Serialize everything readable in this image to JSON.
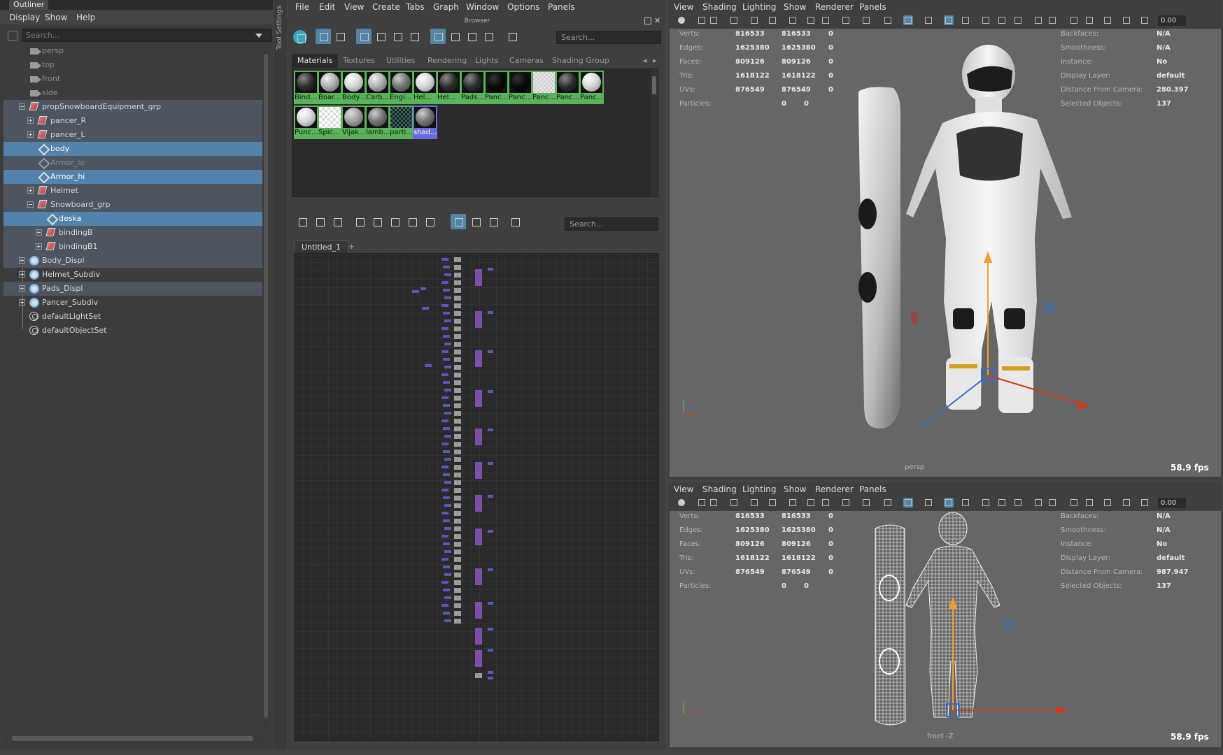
{
  "outliner": {
    "title": "Outliner",
    "menu": [
      "Display",
      "Show",
      "Help"
    ],
    "search_placeholder": "Search...",
    "items": [
      {
        "label": "persp",
        "icon": "camera-icon",
        "state": "dim"
      },
      {
        "label": "top",
        "icon": "camera-icon",
        "state": "dim"
      },
      {
        "label": "front",
        "icon": "camera-icon",
        "state": "dim"
      },
      {
        "label": "side",
        "icon": "camera-icon",
        "state": "dim"
      },
      {
        "label": "propSnowboardEquipment_grp",
        "icon": "transform-icon",
        "state": "grp"
      },
      {
        "label": "pancer_R",
        "icon": "transform-icon",
        "state": "grp"
      },
      {
        "label": "pancer_L",
        "icon": "transform-icon",
        "state": "grp"
      },
      {
        "label": "body",
        "icon": "mesh-icon",
        "state": "sel"
      },
      {
        "label": "Armor_lo",
        "icon": "mesh-icon",
        "state": "grpdim"
      },
      {
        "label": "Armor_hi",
        "icon": "mesh-icon",
        "state": "sel"
      },
      {
        "label": "Helmet",
        "icon": "transform-icon",
        "state": "grp"
      },
      {
        "label": "Snowboard_grp",
        "icon": "transform-icon",
        "state": "grp"
      },
      {
        "label": "deska",
        "icon": "mesh-icon",
        "state": "sel"
      },
      {
        "label": "bindingB",
        "icon": "transform-icon",
        "state": "grp"
      },
      {
        "label": "bindingB1",
        "icon": "transform-icon",
        "state": "grp"
      },
      {
        "label": "Body_Displ",
        "icon": "subdiv-icon",
        "state": "grp"
      },
      {
        "label": "Helmet_Subdiv",
        "icon": "subdiv-icon",
        "state": "normal"
      },
      {
        "label": "Pads_Displ",
        "icon": "subdiv-icon",
        "state": "grp"
      },
      {
        "label": "Pancer_Subdiv",
        "icon": "subdiv-icon",
        "state": "normal"
      },
      {
        "label": "defaultLightSet",
        "icon": "set-icon",
        "state": "normal"
      },
      {
        "label": "defaultObjectSet",
        "icon": "set-icon",
        "state": "normal"
      }
    ]
  },
  "tool_settings_label": "Tool Settings",
  "hypershade": {
    "menu": [
      "File",
      "Edit",
      "View",
      "Create",
      "Tabs",
      "Graph",
      "Window",
      "Options",
      "Panels"
    ],
    "browser_title": "Browser",
    "browser_search_placeholder": "Search...",
    "browser_tabs": [
      "Materials",
      "Textures",
      "Utilities",
      "Rendering",
      "Lights",
      "Cameras",
      "Shading Group"
    ],
    "active_browser_tab": "Materials",
    "swatches": [
      {
        "name": "Bind...",
        "look": "dark-noise"
      },
      {
        "name": "Boar...",
        "look": "grey"
      },
      {
        "name": "Body...",
        "look": "white"
      },
      {
        "name": "Carb...",
        "look": "grey"
      },
      {
        "name": "Engi...",
        "look": "grey-dark"
      },
      {
        "name": "Hel...",
        "look": "white"
      },
      {
        "name": "Hel...",
        "look": "dark-noise"
      },
      {
        "name": "Pads...",
        "look": "dark-noise"
      },
      {
        "name": "Panc...",
        "look": "black"
      },
      {
        "name": "Panc...",
        "look": "black"
      },
      {
        "name": "Panc...",
        "look": "checker-light"
      },
      {
        "name": "Panc...",
        "look": "dark-noise"
      },
      {
        "name": "Panc...",
        "look": "white"
      },
      {
        "name": "Punc...",
        "look": "white"
      },
      {
        "name": "Spic...",
        "look": "checker"
      },
      {
        "name": "Vijak...",
        "look": "grey-noise"
      },
      {
        "name": "lamb...",
        "look": "grey-dark"
      },
      {
        "name": "parti...",
        "look": "checker-dark"
      },
      {
        "name": "shad...",
        "look": "grey-dark",
        "selected": true
      }
    ],
    "graph_search_placeholder": "Search...",
    "graph_tab": "Untitled_1",
    "add_tab": "+"
  },
  "viewport_menu": [
    "View",
    "Shading",
    "Lighting",
    "Show",
    "Renderer",
    "Panels"
  ],
  "viewports": [
    {
      "camera": "persp",
      "fps": "58.9 fps",
      "field_value": "0.00",
      "stats": [
        {
          "label": "Verts:",
          "a": "816533",
          "b": "816533",
          "c": "0"
        },
        {
          "label": "Edges:",
          "a": "1625380",
          "b": "1625380",
          "c": "0"
        },
        {
          "label": "Faces:",
          "a": "809126",
          "b": "809126",
          "c": "0"
        },
        {
          "label": "Tris:",
          "a": "1618122",
          "b": "1618122",
          "c": "0"
        },
        {
          "label": "UVs:",
          "a": "876549",
          "b": "876549",
          "c": "0"
        },
        {
          "label": "Particles:",
          "a": "",
          "b": "0",
          "c": "0"
        }
      ],
      "info": [
        {
          "label": "Backfaces:",
          "value": "N/A"
        },
        {
          "label": "Smoothness:",
          "value": "N/A"
        },
        {
          "label": "Instance:",
          "value": "No"
        },
        {
          "label": "Display Layer:",
          "value": "default"
        },
        {
          "label": "Distance From Camera:",
          "value": "280.397"
        },
        {
          "label": "Selected Objects:",
          "value": "137"
        }
      ]
    },
    {
      "camera": "front -Z",
      "fps": "58.9 fps",
      "field_value": "0.00",
      "stats": [
        {
          "label": "Verts:",
          "a": "816533",
          "b": "816533",
          "c": "0"
        },
        {
          "label": "Edges:",
          "a": "1625380",
          "b": "1625380",
          "c": "0"
        },
        {
          "label": "Faces:",
          "a": "809126",
          "b": "809126",
          "c": "0"
        },
        {
          "label": "Tris:",
          "a": "1618122",
          "b": "1618122",
          "c": "0"
        },
        {
          "label": "UVs:",
          "a": "876549",
          "b": "876549",
          "c": "0"
        },
        {
          "label": "Particles:",
          "a": "",
          "b": "0",
          "c": "0"
        }
      ],
      "info": [
        {
          "label": "Backfaces:",
          "value": "N/A"
        },
        {
          "label": "Smoothness:",
          "value": "N/A"
        },
        {
          "label": "Instance:",
          "value": "No"
        },
        {
          "label": "Display Layer:",
          "value": "default"
        },
        {
          "label": "Distance From Camera:",
          "value": "987.947"
        },
        {
          "label": "Selected Objects:",
          "value": "137"
        }
      ]
    }
  ],
  "colors": {
    "selection": "#5383ac",
    "group_highlight": "#4c5560",
    "swatch_active": "#5ab35a",
    "swatch_selected": "#6b6be0",
    "manip_y": "#f0a030",
    "manip_x": "#d03a1a",
    "manip_z": "#3a6ad0"
  }
}
